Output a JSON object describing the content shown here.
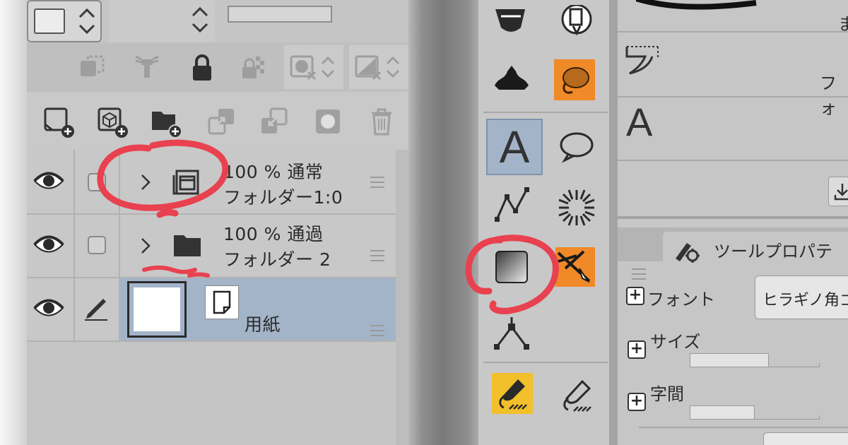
{
  "layers": [
    {
      "opacity_mode": "100 % 通常",
      "name": "フォルダー1:0",
      "type": "folder-open"
    },
    {
      "opacity_mode": "100 % 通過",
      "name": "フォルダー 2",
      "type": "folder"
    },
    {
      "opacity_mode": "",
      "name": "用紙",
      "type": "paper"
    }
  ],
  "properties": {
    "tab_title": "ツールプロパテ",
    "font_label": "フォント",
    "font_value": "ヒラギノ角ゴ",
    "size_label": "サイズ",
    "spacing_label": "字間"
  },
  "sub_panel": {
    "label_1": "ま",
    "label_2": "フォ",
    "text_tool_glyph": "A"
  },
  "tools": {
    "text_tool_glyph": "A"
  },
  "colors": {
    "annotation_red": "#e8414f",
    "selected_layer_bg": "#a3b4c9",
    "orange_tool": "#f08a28",
    "yellow_tool": "#f2c02a"
  }
}
